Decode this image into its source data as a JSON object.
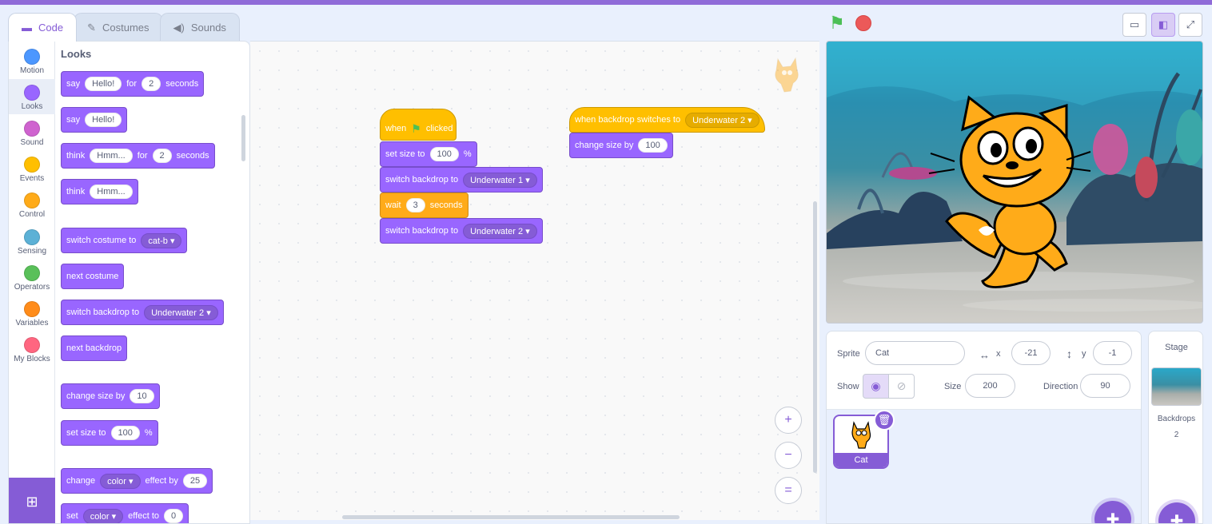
{
  "tabs": [
    {
      "label": "Code",
      "icon": "code-icon",
      "active": true
    },
    {
      "label": "Costumes",
      "icon": "brush-icon",
      "active": false
    },
    {
      "label": "Sounds",
      "icon": "speaker-icon",
      "active": false
    }
  ],
  "categories": [
    {
      "label": "Motion",
      "color": "#4c97ff"
    },
    {
      "label": "Looks",
      "color": "#9966ff"
    },
    {
      "label": "Sound",
      "color": "#cf63cf"
    },
    {
      "label": "Events",
      "color": "#ffbf00"
    },
    {
      "label": "Control",
      "color": "#ffab19"
    },
    {
      "label": "Sensing",
      "color": "#5cb1d6"
    },
    {
      "label": "Operators",
      "color": "#59c059"
    },
    {
      "label": "Variables",
      "color": "#ff8c1a"
    },
    {
      "label": "My Blocks",
      "color": "#ff6680"
    }
  ],
  "palette": {
    "title": "Looks",
    "say_for": {
      "say": "say",
      "msg": "Hello!",
      "for": "for",
      "secs": "2",
      "seconds": "seconds"
    },
    "say": {
      "say": "say",
      "msg": "Hello!"
    },
    "think_for": {
      "think": "think",
      "msg": "Hmm...",
      "for": "for",
      "secs": "2",
      "seconds": "seconds"
    },
    "think": {
      "think": "think",
      "msg": "Hmm..."
    },
    "switch_costume": {
      "label": "switch costume to",
      "value": "cat-b"
    },
    "next_costume": "next costume",
    "switch_backdrop": {
      "label": "switch backdrop to",
      "value": "Underwater 2"
    },
    "next_backdrop": "next backdrop",
    "change_size": {
      "label": "change size by",
      "value": "10"
    },
    "set_size": {
      "label": "set size to",
      "value": "100",
      "unit": "%"
    },
    "change_effect": {
      "change": "change",
      "effect": "color",
      "by": "effect by",
      "value": "25"
    },
    "set_effect": {
      "set": "set",
      "effect": "color",
      "to": "effect to",
      "value": "0"
    }
  },
  "scripts": {
    "flag_script": {
      "when": "when",
      "clicked": "clicked",
      "set_size": {
        "label": "set size to",
        "value": "100",
        "unit": "%"
      },
      "switch1": {
        "label": "switch backdrop to",
        "value": "Underwater 1"
      },
      "wait": {
        "label": "wait",
        "value": "3",
        "unit": "seconds"
      },
      "switch2": {
        "label": "switch backdrop to",
        "value": "Underwater 2"
      }
    },
    "backdrop_script": {
      "hat": {
        "label": "when backdrop switches to",
        "value": "Underwater 2"
      },
      "change_size": {
        "label": "change size by",
        "value": "100"
      }
    }
  },
  "zoom": {
    "in": "+",
    "out": "−",
    "reset": "="
  },
  "sprite_info": {
    "sprite_label": "Sprite",
    "sprite_name": "Cat",
    "x_label": "x",
    "x_value": "-21",
    "y_label": "y",
    "y_value": "-1",
    "show_label": "Show",
    "size_label": "Size",
    "size_value": "200",
    "direction_label": "Direction",
    "direction_value": "90"
  },
  "sprites": [
    {
      "name": "Cat",
      "selected": true
    }
  ],
  "stage_panel": {
    "title": "Stage",
    "backdrops_label": "Backdrops",
    "backdrops_count": "2"
  },
  "colors": {
    "accent": "#855cd6",
    "looks": "#9966ff",
    "events": "#ffbf00",
    "control": "#ffab19"
  }
}
